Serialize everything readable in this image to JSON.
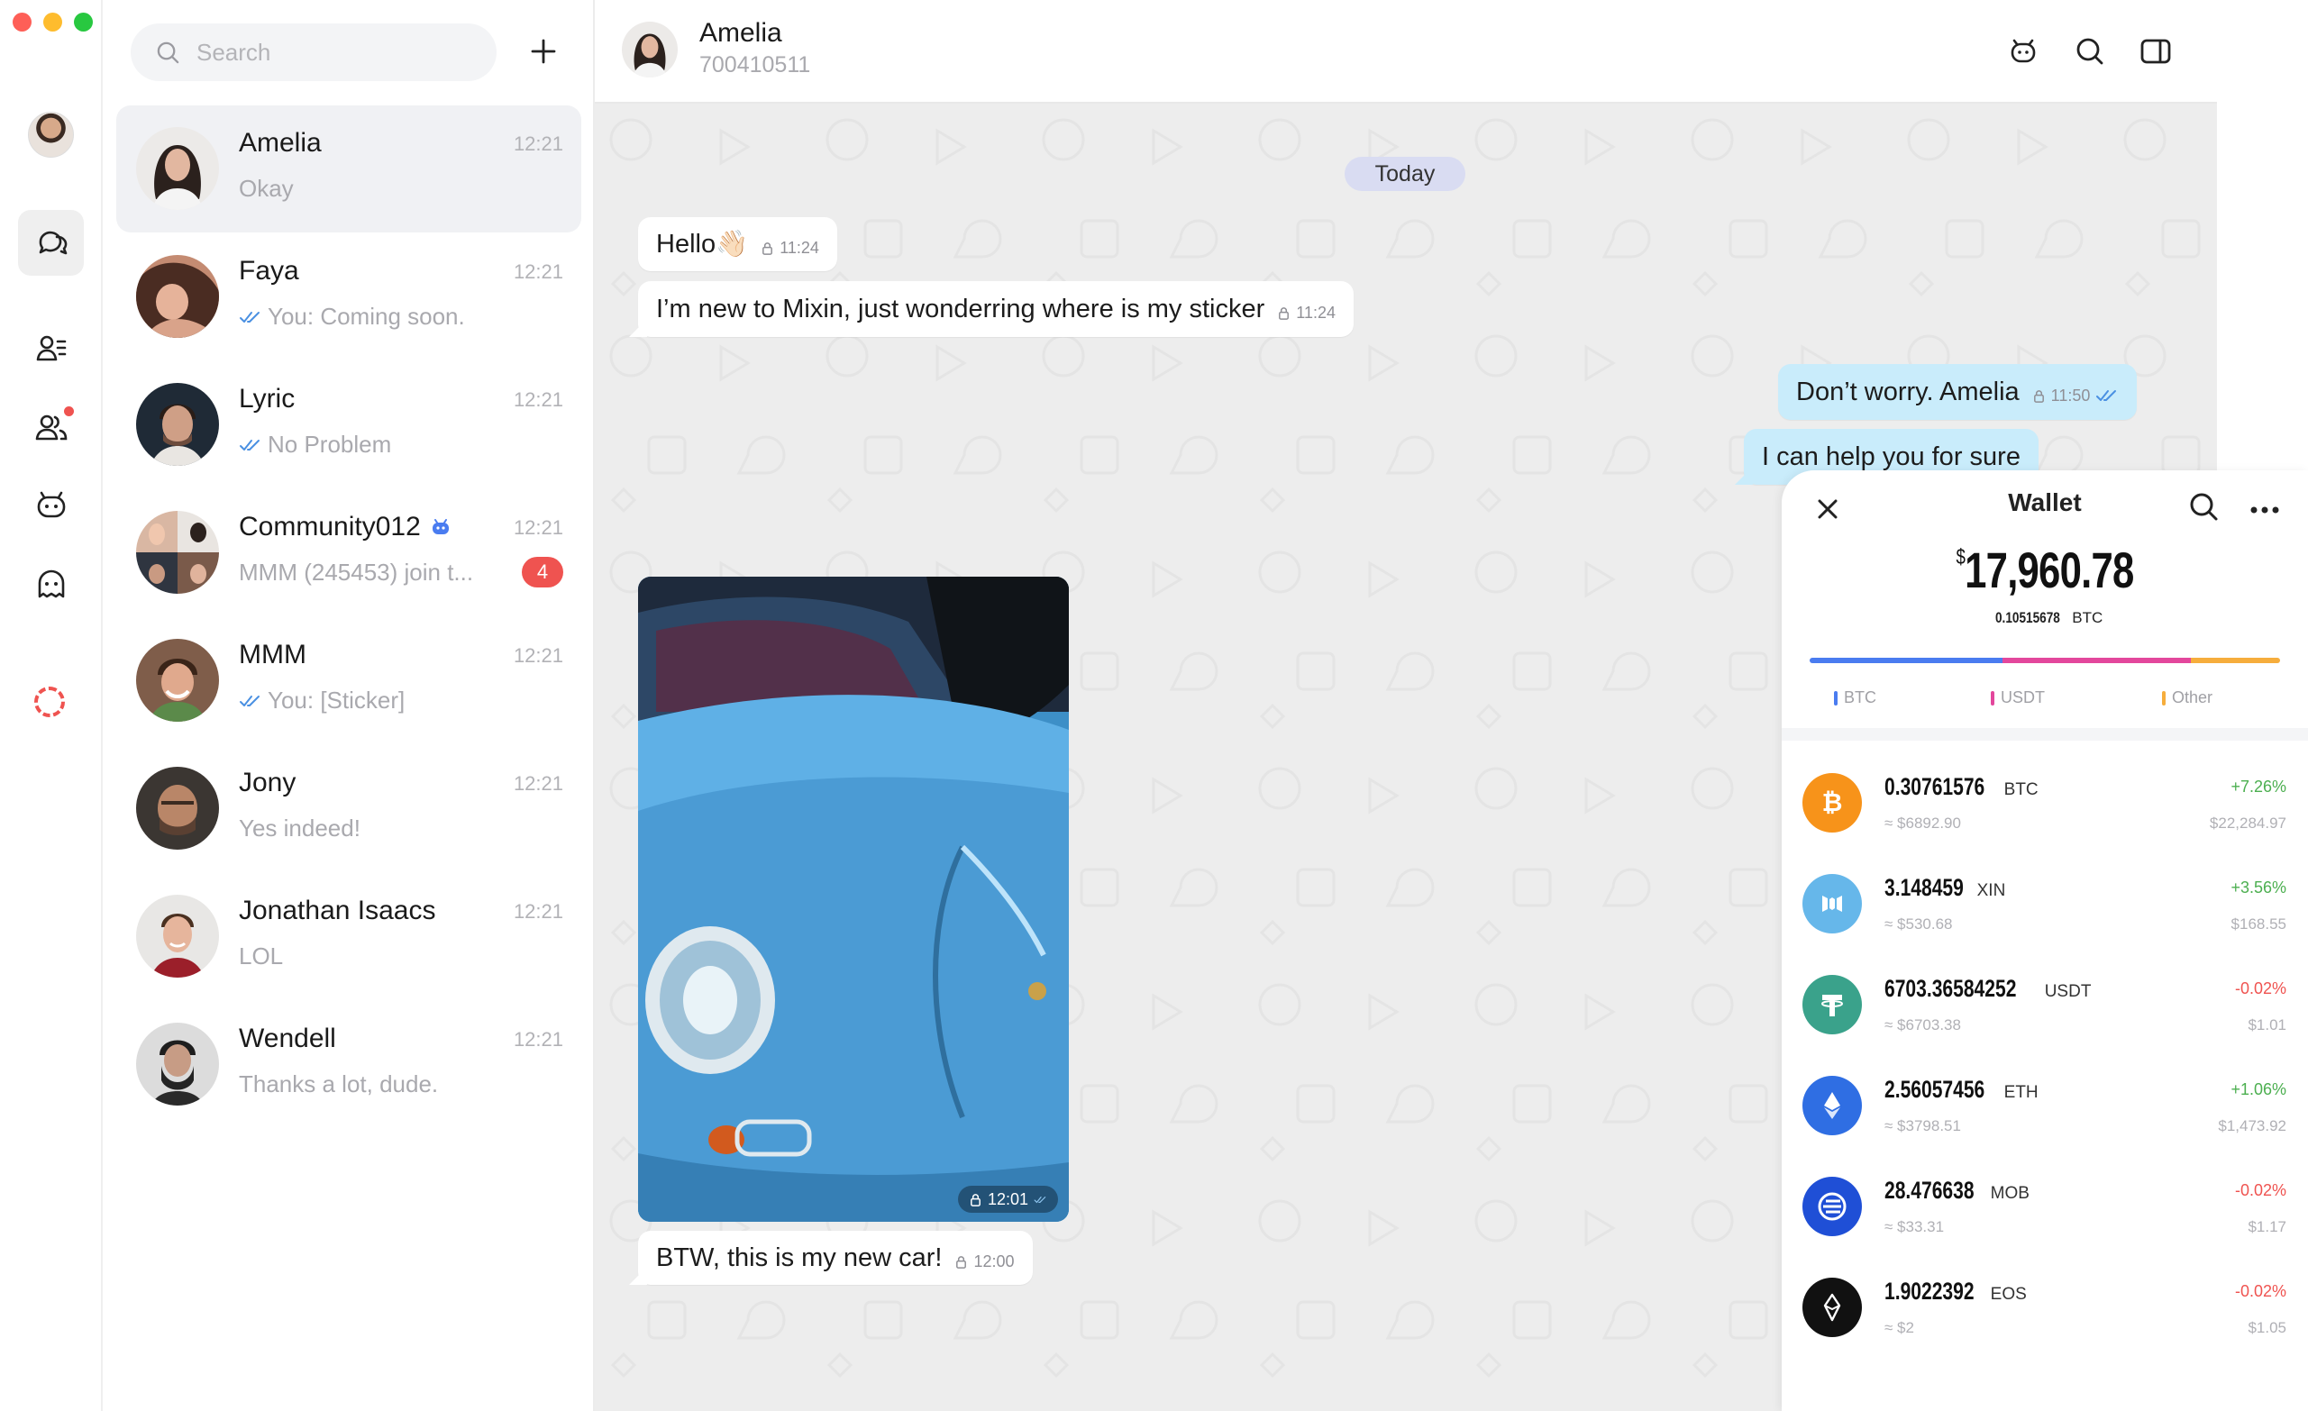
{
  "colors": {
    "accent_blue": "#4a90e2",
    "badge_red": "#ef5350",
    "outgoing_bubble": "#c9ecfb",
    "incoming_bubble": "#ffffff",
    "positive": "#4caf50",
    "negative": "#ef5350"
  },
  "rail": {
    "icons": [
      "chats-icon",
      "contacts-icon",
      "circles-icon",
      "bot-icon",
      "ghost-icon",
      "loading-ring-icon"
    ]
  },
  "list": {
    "search_placeholder": "Search",
    "conversations": [
      {
        "name": "Amelia",
        "time": "12:21",
        "preview": "Okay",
        "read": false,
        "badge": ""
      },
      {
        "name": "Faya",
        "time": "12:21",
        "preview": "You: Coming soon.",
        "read": true,
        "badge": ""
      },
      {
        "name": "Lyric",
        "time": "12:21",
        "preview": "No Problem",
        "read": true,
        "badge": ""
      },
      {
        "name": "Community012",
        "time": "12:21",
        "preview": "MMM (245453) join t...",
        "read": false,
        "badge": "4"
      },
      {
        "name": "MMM",
        "time": "12:21",
        "preview": "You: [Sticker]",
        "read": true,
        "badge": ""
      },
      {
        "name": "Jony",
        "time": "12:21",
        "preview": "Yes indeed!",
        "read": false,
        "badge": ""
      },
      {
        "name": "Jonathan Isaacs",
        "time": "12:21",
        "preview": "LOL",
        "read": false,
        "badge": ""
      },
      {
        "name": "Wendell",
        "time": "12:21",
        "preview": "Thanks a lot, dude.",
        "read": false,
        "badge": ""
      }
    ]
  },
  "chat": {
    "title": "Amelia",
    "subtitle": "700410511",
    "date_divider": "Today",
    "messages": [
      {
        "text": "Hello👋🏻",
        "time": "11:24"
      },
      {
        "text": "I’m new to Mixin, just wonderring where is my sticker",
        "time": "11:24"
      },
      {
        "text": "Don’t worry. Amelia",
        "time": "11:50"
      },
      {
        "text": "I can help you for sure",
        "time": ""
      },
      {
        "text": "BTW, this is my new car!",
        "time": "12:00"
      }
    ],
    "photo_time": "12:01"
  },
  "wallet": {
    "title": "Wallet",
    "currency_symbol": "$",
    "total": "17,960.78",
    "btc_amount": "0.10515678",
    "btc_unit": "BTC",
    "distribution": [
      {
        "label": "BTC",
        "share": 0.41,
        "color": "#4a7cf0"
      },
      {
        "label": "USDT",
        "share": 0.4,
        "color": "#e3479c"
      },
      {
        "label": "Other",
        "share": 0.19,
        "color": "#f6ad3c"
      }
    ],
    "assets": [
      {
        "amount": "0.30761576",
        "symbol": "BTC",
        "usd": "≈ $6892.90",
        "change": "+7.26%",
        "value": "$22,284.97",
        "color": "#f7931a",
        "icon": "bitcoin-icon",
        "up": true
      },
      {
        "amount": "3.148459",
        "symbol": "XIN",
        "usd": "≈ $530.68",
        "change": "+3.56%",
        "value": "$168.55",
        "color": "#66b7ea",
        "icon": "xin-icon",
        "up": true
      },
      {
        "amount": "6703.36584252",
        "symbol": "USDT",
        "usd": "≈ $6703.38",
        "change": "-0.02%",
        "value": "$1.01",
        "color": "#3aa28b",
        "icon": "tether-icon",
        "up": false
      },
      {
        "amount": "2.56057456",
        "symbol": "ETH",
        "usd": "≈ $3798.51",
        "change": "+1.06%",
        "value": "$1,473.92",
        "color": "#2f6ee3",
        "icon": "ethereum-icon",
        "up": true
      },
      {
        "amount": "28.476638",
        "symbol": "MOB",
        "usd": "≈ $33.31",
        "change": "-0.02%",
        "value": "$1.17",
        "color": "#1f4fd6",
        "icon": "mobilecoin-icon",
        "up": false
      },
      {
        "amount": "1.9022392",
        "symbol": "EOS",
        "usd": "≈ $2",
        "change": "-0.02%",
        "value": "$1.05",
        "color": "#111111",
        "icon": "eos-icon",
        "up": false
      }
    ]
  }
}
